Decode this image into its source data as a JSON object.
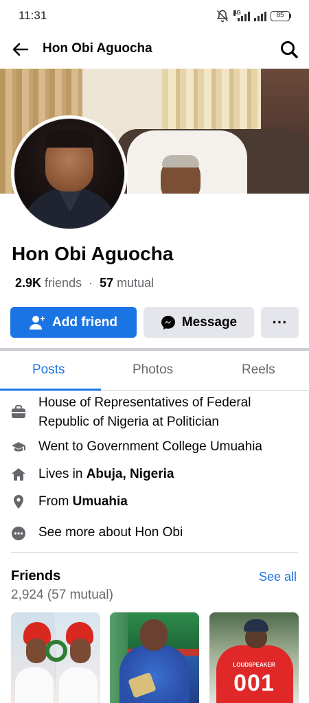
{
  "status_bar": {
    "time": "11:31",
    "network": "4G",
    "battery": "85"
  },
  "top_bar": {
    "title": "Hon Obi Aguocha"
  },
  "profile": {
    "name": "Hon Obi Aguocha",
    "friends_count": "2.9K",
    "friends_word": "friends",
    "separator": "·",
    "mutual_count": "57",
    "mutual_word": "mutual"
  },
  "actions": {
    "add_friend": "Add friend",
    "message": "Message",
    "more": "···"
  },
  "tabs": [
    {
      "label": "Posts",
      "active": true
    },
    {
      "label": "Photos",
      "active": false
    },
    {
      "label": "Reels",
      "active": false
    }
  ],
  "about": {
    "work": "House of Representatives of Federal Republic of Nigeria at Politician",
    "education": "Went to Government College Umuahia",
    "lives_prefix": "Lives in ",
    "lives_place": "Abuja, Nigeria",
    "from_prefix": "From ",
    "from_place": "Umuahia",
    "see_more": "See more about Hon Obi"
  },
  "friends_section": {
    "title": "Friends",
    "see_all": "See all",
    "count_text": "2,924 (57 mutual)",
    "jersey_text": "LOUDSPEAKER",
    "jersey_number": "001"
  },
  "colors": {
    "accent": "#1b74e4",
    "secondary_button": "#e4e6eb",
    "muted_text": "#65676b"
  },
  "icons": [
    "back-arrow-icon",
    "search-icon",
    "add-friend-icon",
    "messenger-icon",
    "briefcase-icon",
    "graduation-cap-icon",
    "home-icon",
    "location-pin-icon",
    "more-dots-icon"
  ]
}
